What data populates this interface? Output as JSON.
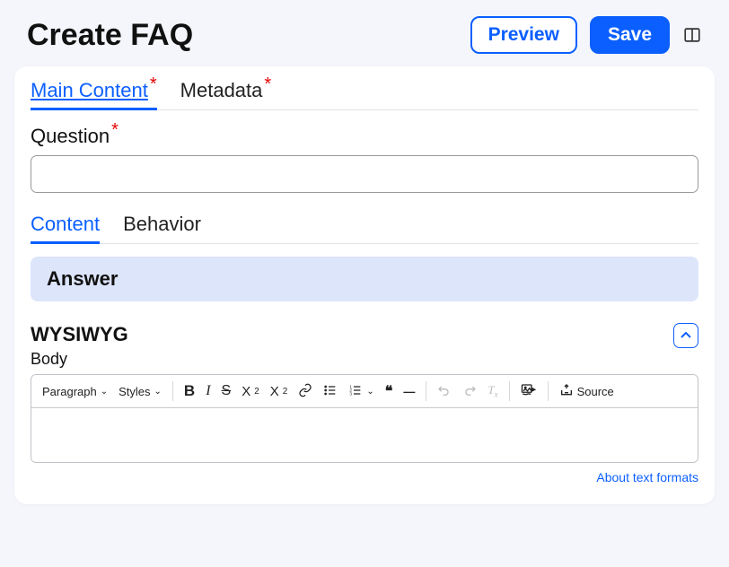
{
  "header": {
    "title": "Create FAQ",
    "preview_label": "Preview",
    "save_label": "Save"
  },
  "mainTabs": {
    "main_content": "Main Content",
    "metadata": "Metadata"
  },
  "question": {
    "label": "Question",
    "value": ""
  },
  "subTabs": {
    "content": "Content",
    "behavior": "Behavior"
  },
  "answer": {
    "title": "Answer"
  },
  "wysiwyg": {
    "title": "WYSIWYG",
    "body_label": "Body",
    "toolbar": {
      "paragraph": "Paragraph",
      "styles": "Styles",
      "source": "Source"
    },
    "about_link": "About text formats"
  }
}
